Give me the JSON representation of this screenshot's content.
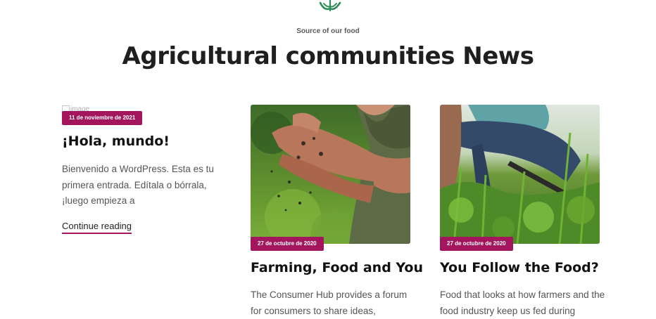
{
  "header": {
    "eyebrow": "Source of our food",
    "title": "Agricultural communities News",
    "logo_icon": "leaf-icon",
    "logo_color": "#2e8b57"
  },
  "accent_color": "#a3165e",
  "posts": [
    {
      "image_alt": "image",
      "date": "11 de noviembre de 2021",
      "title": "¡Hola, mundo!",
      "excerpt": "Bienvenido a WordPress. Esta es tu primera entrada. Edítala o bórrala, ¡luego empieza a",
      "read_more": "Continue reading"
    },
    {
      "image_subject": "hands holding soil",
      "date": "27 de octubre de 2020",
      "title": "Farming, Food and You",
      "excerpt": "The Consumer Hub provides a forum for consumers to share ideas,"
    },
    {
      "image_subject": "farmer working in crop field",
      "date": "27 de octubre de 2020",
      "title": "You Follow the Food?",
      "excerpt": "Food that looks at how farmers and the food industry keep us fed during"
    }
  ]
}
